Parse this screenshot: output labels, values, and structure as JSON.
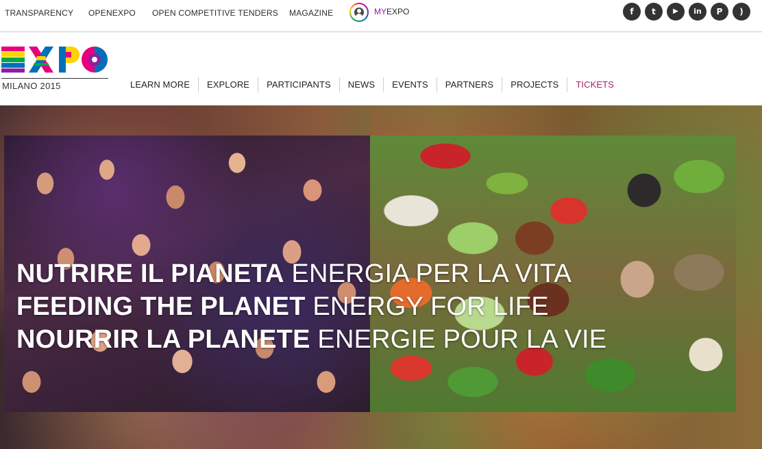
{
  "top_links": [
    "TRANSPARENCY",
    "OPENEXPO",
    "OPEN COMPETITIVE TENDERS",
    "MAGAZINE"
  ],
  "myexpo": {
    "prefix": "MY",
    "suffix": "EXPO"
  },
  "social": [
    {
      "name": "facebook-icon",
      "glyph": "f"
    },
    {
      "name": "twitter-icon",
      "glyph": "t"
    },
    {
      "name": "youtube-icon",
      "glyph": "▶"
    },
    {
      "name": "linkedin-icon",
      "glyph": "in"
    },
    {
      "name": "pinterest-icon",
      "glyph": "P"
    },
    {
      "name": "rss-icon",
      "glyph": ")"
    }
  ],
  "logo": {
    "text": "EXPO",
    "subtitle": "MILANO 2015"
  },
  "nav": [
    "LEARN MORE",
    "EXPLORE",
    "PARTICIPANTS",
    "NEWS",
    "EVENTS",
    "PARTNERS",
    "PROJECTS",
    "TICKETS"
  ],
  "hero": {
    "lines": [
      {
        "bold": "NUTRIRE IL PIANETA",
        "light": "ENERGIA PER LA VITA"
      },
      {
        "bold": "FEEDING THE PLANET",
        "light": "ENERGY FOR LIFE"
      },
      {
        "bold": "NOURRIR LA PLANETE",
        "light": "ENERGIE POUR LA VIE"
      }
    ]
  },
  "colors": {
    "accent_tickets": "#a21f6e",
    "myexpo_purple": "#8c1fa5",
    "social_bg": "#333333"
  }
}
